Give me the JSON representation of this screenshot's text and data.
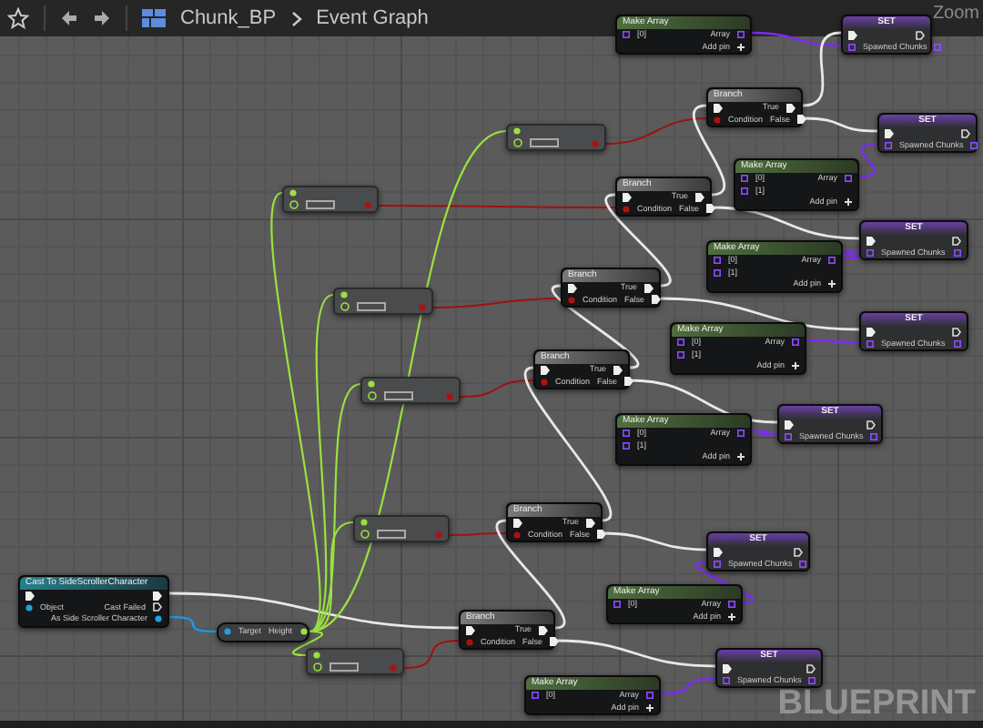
{
  "toolbar": {
    "breadcrumb": [
      {
        "label": "Chunk_BP"
      },
      {
        "label": "Event Graph"
      }
    ]
  },
  "graph": {
    "zoom_label": "Zoom",
    "watermark": "BLUEPRINT",
    "nodes": [
      {
        "kind": "make_array",
        "title": "Make Array",
        "inputs": [
          "[0]"
        ],
        "output": "Array",
        "add_pin": "Add pin"
      },
      {
        "kind": "set",
        "title": "SET",
        "variable": "Spawned Chunks"
      },
      {
        "kind": "branch",
        "title": "Branch",
        "true_label": "True",
        "false_label": "False",
        "condition": "Condition"
      },
      {
        "kind": "set",
        "title": "SET",
        "variable": "Spawned Chunks"
      },
      {
        "kind": "compare"
      },
      {
        "kind": "make_array",
        "title": "Make Array",
        "inputs": [
          "[0]",
          "[1]"
        ],
        "output": "Array",
        "add_pin": "Add pin"
      },
      {
        "kind": "branch",
        "title": "Branch",
        "true_label": "True",
        "false_label": "False",
        "condition": "Condition"
      },
      {
        "kind": "compare"
      },
      {
        "kind": "set",
        "title": "SET",
        "variable": "Spawned Chunks"
      },
      {
        "kind": "make_array",
        "title": "Make Array",
        "inputs": [
          "[0]",
          "[1]"
        ],
        "output": "Array",
        "add_pin": "Add pin"
      },
      {
        "kind": "branch",
        "title": "Branch",
        "true_label": "True",
        "false_label": "False",
        "condition": "Condition"
      },
      {
        "kind": "compare"
      },
      {
        "kind": "set",
        "title": "SET",
        "variable": "Spawned Chunks"
      },
      {
        "kind": "make_array",
        "title": "Make Array",
        "inputs": [
          "[0]",
          "[1]"
        ],
        "output": "Array",
        "add_pin": "Add pin"
      },
      {
        "kind": "branch",
        "title": "Branch",
        "true_label": "True",
        "false_label": "False",
        "condition": "Condition"
      },
      {
        "kind": "compare"
      },
      {
        "kind": "set",
        "title": "SET",
        "variable": "Spawned Chunks"
      },
      {
        "kind": "make_array",
        "title": "Make Array",
        "inputs": [
          "[0]",
          "[1]"
        ],
        "output": "Array",
        "add_pin": "Add pin"
      },
      {
        "kind": "branch",
        "title": "Branch",
        "true_label": "True",
        "false_label": "False",
        "condition": "Condition"
      },
      {
        "kind": "compare"
      },
      {
        "kind": "set",
        "title": "SET",
        "variable": "Spawned Chunks"
      },
      {
        "kind": "cast",
        "title": "Cast To SideScrollerCharacter",
        "object": "Object",
        "failed": "Cast Failed",
        "output": "As Side Scroller Character"
      },
      {
        "kind": "make_array",
        "title": "Make Array",
        "inputs": [
          "[0]"
        ],
        "output": "Array",
        "add_pin": "Add pin"
      },
      {
        "kind": "getter",
        "target": "Target",
        "output": "Height"
      },
      {
        "kind": "branch",
        "title": "Branch",
        "true_label": "True",
        "false_label": "False",
        "condition": "Condition"
      },
      {
        "kind": "set",
        "title": "SET",
        "variable": "Spawned Chunks"
      },
      {
        "kind": "compare"
      },
      {
        "kind": "make_array",
        "title": "Make Array",
        "inputs": [
          "[0]"
        ],
        "output": "Array",
        "add_pin": "Add pin"
      }
    ]
  }
}
